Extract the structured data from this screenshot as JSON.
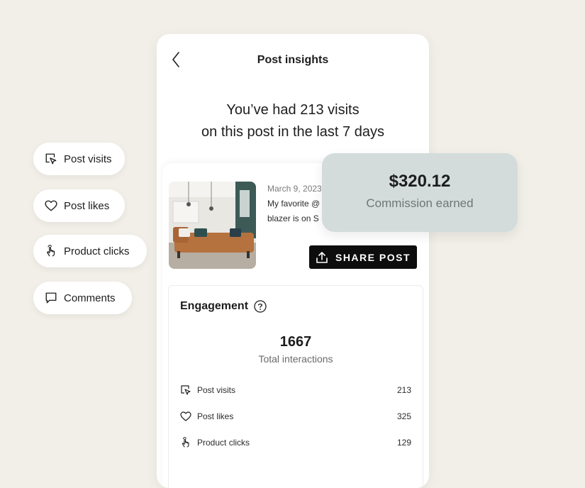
{
  "header": {
    "title": "Post insights"
  },
  "summary": {
    "line1": "You’ve had 213 visits",
    "line2": "on this post in the last 7 days"
  },
  "post": {
    "date": "March 9, 2023",
    "caption_line1": "My favorite @",
    "caption_line2": "blazer is on S",
    "share_label": "SHARE POST"
  },
  "commission": {
    "amount": "$320.12",
    "label": "Commission earned"
  },
  "engagement": {
    "title": "Engagement",
    "total_value": "1667",
    "total_label": "Total interactions",
    "rows": [
      {
        "label": "Post visits",
        "value": "213",
        "icon": "cursor-icon"
      },
      {
        "label": "Post likes",
        "value": "325",
        "icon": "heart-icon"
      },
      {
        "label": "Product clicks",
        "value": "129",
        "icon": "tap-hand-icon"
      }
    ]
  },
  "filters": [
    {
      "label": "Post visits",
      "icon": "cursor-icon"
    },
    {
      "label": "Post likes",
      "icon": "heart-icon"
    },
    {
      "label": "Product clicks",
      "icon": "tap-hand-icon"
    },
    {
      "label": "Comments",
      "icon": "comment-icon"
    }
  ],
  "colors": {
    "background": "#f2efe9",
    "commission_card": "#d3dcda",
    "share_button": "#0d0d0d"
  }
}
